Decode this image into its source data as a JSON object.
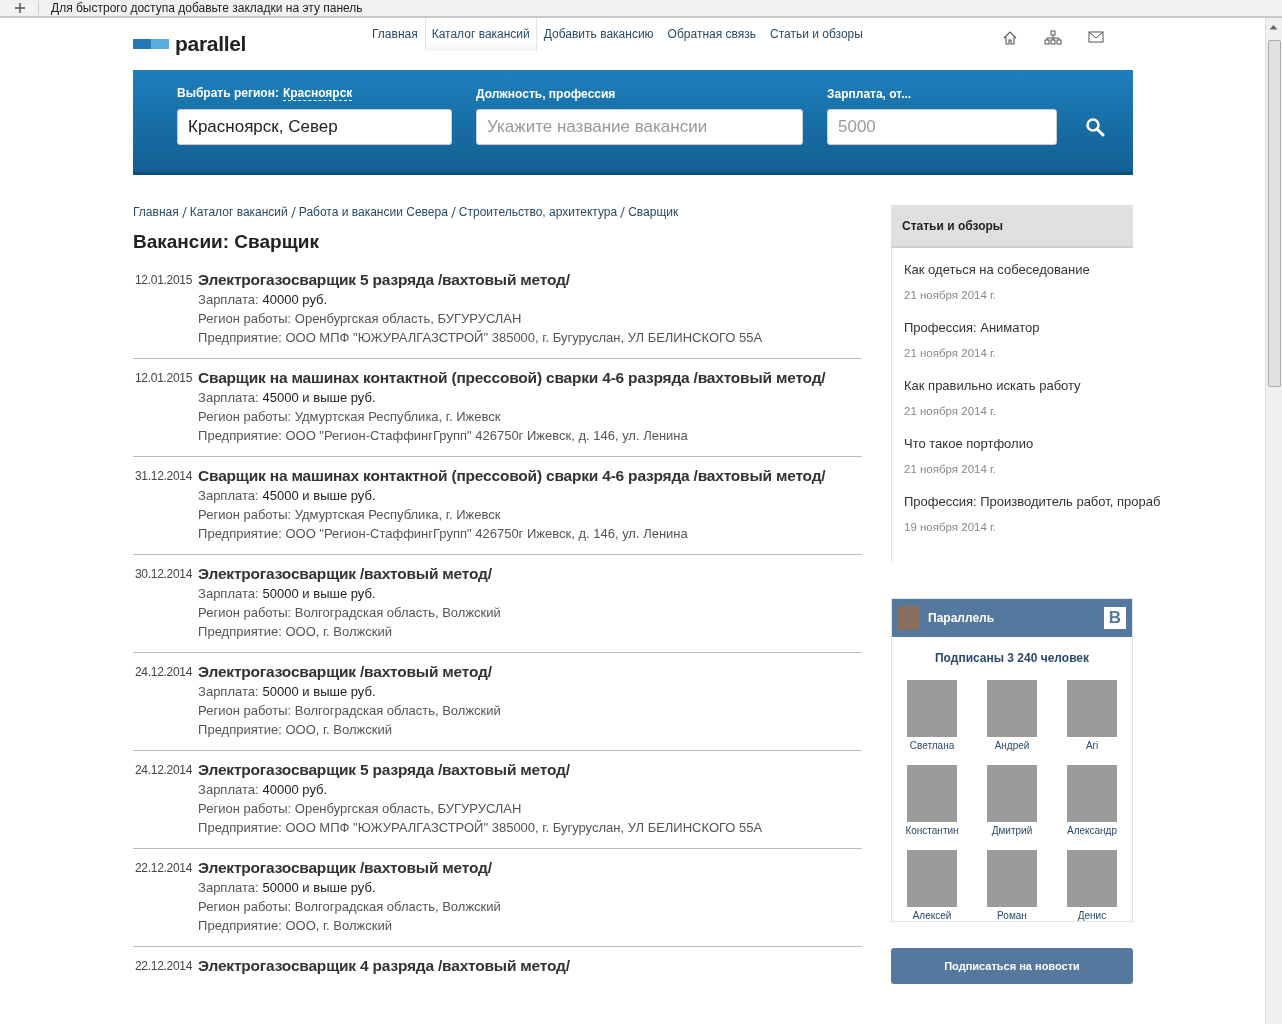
{
  "browser_bar": {
    "text": "Для быстрого доступа добавьте закладки на эту панель"
  },
  "header": {
    "logo": "parallel",
    "nav": [
      {
        "label": "Главная",
        "selected": false
      },
      {
        "label": "Каталог вакансий",
        "selected": true
      },
      {
        "label": "Добавить вакансию",
        "selected": false
      },
      {
        "label": "Обратная связь",
        "selected": false
      },
      {
        "label": "Статьи и обзоры",
        "selected": false
      }
    ]
  },
  "search": {
    "region_label": "Выбрать регион:",
    "region_link": "Красноярск",
    "region_value": "Красноярск, Север",
    "position_label": "Должность, профессия",
    "position_placeholder": "Укажите название вакансии",
    "salary_label": "Зарплата, от...",
    "salary_placeholder": "5000"
  },
  "breadcrumbs": [
    "Главная",
    "Каталог вакансий",
    "Работа и вакансии Севера",
    "Строительство, архитектура",
    "Сварщик"
  ],
  "title": "Вакансии: Сварщик",
  "vacancies": [
    {
      "date": "12.01.2015",
      "title": "Электрогазосварщик 5 разряда /вахтовый метод/",
      "salary_label": "Зарплата:",
      "salary": "40000 руб.",
      "region": "Регион работы: Оренбургская область, БУГУРУСЛАН",
      "company": "Предприятие: ООО МПФ \"ЮЖУРАЛГАЗСТРОЙ\" 385000, г. Бугуруслан, УЛ БЕЛИНСКОГО 55А"
    },
    {
      "date": "12.01.2015",
      "title": "Сварщик на машинах контактной (прессовой) сварки 4-6 разряда /вахтовый метод/",
      "salary_label": "Зарплата:",
      "salary": "45000 и выше руб.",
      "region": "Регион работы: Удмуртская Республика, г. Ижевск",
      "company": "Предприятие: ООО \"Регион-СтаффингГрупп\" 426750г Ижевск, д. 146, ул. Ленина"
    },
    {
      "date": "31.12.2014",
      "title": "Сварщик на машинах контактной (прессовой) сварки 4-6 разряда /вахтовый метод/",
      "salary_label": "Зарплата:",
      "salary": "45000 и выше руб.",
      "region": "Регион работы: Удмуртская Республика, г. Ижевск",
      "company": "Предприятие: ООО \"Регион-СтаффингГрупп\" 426750г Ижевск, д. 146, ул. Ленина"
    },
    {
      "date": "30.12.2014",
      "title": "Электрогазосварщик /вахтовый метод/",
      "salary_label": "Зарплата:",
      "salary": "50000 и выше руб.",
      "region": "Регион работы: Волгоградская область, Волжский",
      "company": "Предприятие: ООО, г. Волжский"
    },
    {
      "date": "24.12.2014",
      "title": "Электрогазосварщик /вахтовый метод/",
      "salary_label": "Зарплата:",
      "salary": "50000 и выше руб.",
      "region": "Регион работы: Волгоградская область, Волжский",
      "company": "Предприятие: ООО, г. Волжский"
    },
    {
      "date": "24.12.2014",
      "title": "Электрогазосварщик 5 разряда /вахтовый метод/",
      "salary_label": "Зарплата:",
      "salary": "40000 руб.",
      "region": "Регион работы: Оренбургская область, БУГУРУСЛАН",
      "company": "Предприятие: ООО МПФ \"ЮЖУРАЛГАЗСТРОЙ\" 385000, г. Бугуруслан, УЛ БЕЛИНСКОГО 55А"
    },
    {
      "date": "22.12.2014",
      "title": "Электрогазосварщик /вахтовый метод/",
      "salary_label": "Зарплата:",
      "salary": "50000 и выше руб.",
      "region": "Регион работы: Волгоградская область, Волжский",
      "company": "Предприятие: ООО, г. Волжский"
    },
    {
      "date": "22.12.2014",
      "title": "Электрогазосварщик 4 разряда /вахтовый метод/"
    }
  ],
  "articles": {
    "title": "Статьи и обзоры",
    "items": [
      {
        "title": "Как одеться на собеседование",
        "date": "21 ноября 2014 г."
      },
      {
        "title": "Профессия: Аниматор",
        "date": "21 ноября 2014 г."
      },
      {
        "title": "Как правильно искать работу",
        "date": "21 ноября 2014 г."
      },
      {
        "title": "Что такое портфолио",
        "date": "21 ноября 2014 г."
      },
      {
        "title": "Профессия: Производитель работ, прораб",
        "date": "19 ноября 2014 г."
      }
    ]
  },
  "vk_widget": {
    "name": "Параллель",
    "badge": "В",
    "subscribers": "Подписаны 3 240 человек",
    "members": [
      "Светлана",
      "Андрей",
      "Ari",
      "Константин",
      "Дмитрий",
      "Александр",
      "Алексей",
      "Роман",
      "Денис"
    ],
    "button": "Подписаться на новости"
  }
}
